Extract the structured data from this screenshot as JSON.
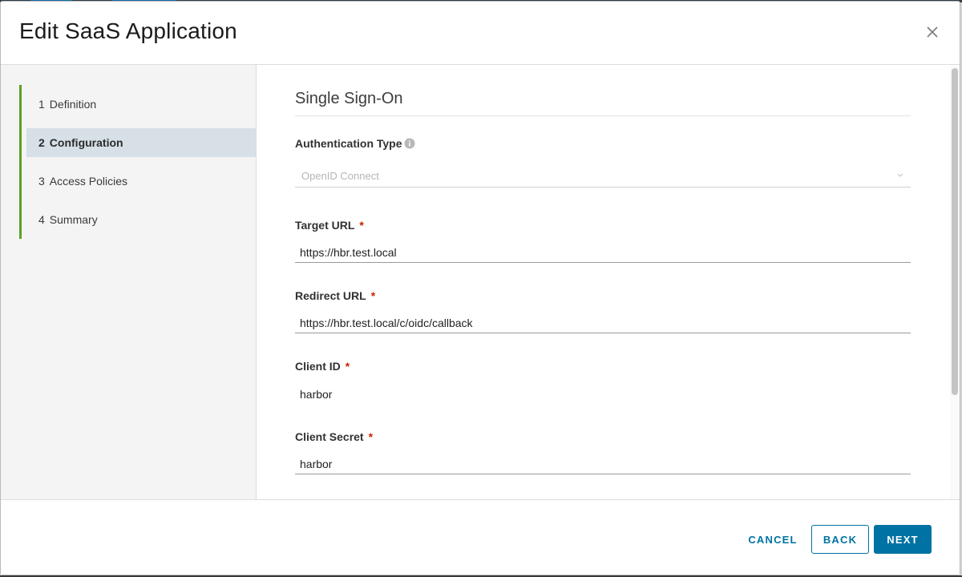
{
  "modal": {
    "title": "Edit SaaS Application"
  },
  "steps": [
    {
      "num": "1",
      "label": "Definition",
      "active": false
    },
    {
      "num": "2",
      "label": "Configuration",
      "active": true
    },
    {
      "num": "3",
      "label": "Access Policies",
      "active": false
    },
    {
      "num": "4",
      "label": "Summary",
      "active": false
    }
  ],
  "section": {
    "title": "Single Sign-On"
  },
  "fields": {
    "auth_type": {
      "label": "Authentication Type",
      "value": "OpenID Connect",
      "required": false
    },
    "target_url": {
      "label": "Target URL",
      "value": "https://hbr.test.local",
      "required_mark": "*"
    },
    "redirect_url": {
      "label": "Redirect URL",
      "value": "https://hbr.test.local/c/oidc/callback",
      "required_mark": "*"
    },
    "client_id": {
      "label": "Client ID",
      "value": "harbor",
      "required_mark": "*"
    },
    "client_secret": {
      "label": "Client Secret",
      "value": "harbor",
      "required_mark": "*"
    }
  },
  "footer": {
    "cancel_label": "CANCEL",
    "back_label": "BACK",
    "next_label": "NEXT"
  },
  "colors": {
    "accent": "#0072a3",
    "step_progress": "#5aa220",
    "required": "#c92100",
    "active_step_bg": "#d6e0e6"
  },
  "icons": {
    "close": "close-icon",
    "info": "info-icon",
    "chevron": "chevron-down-icon"
  }
}
